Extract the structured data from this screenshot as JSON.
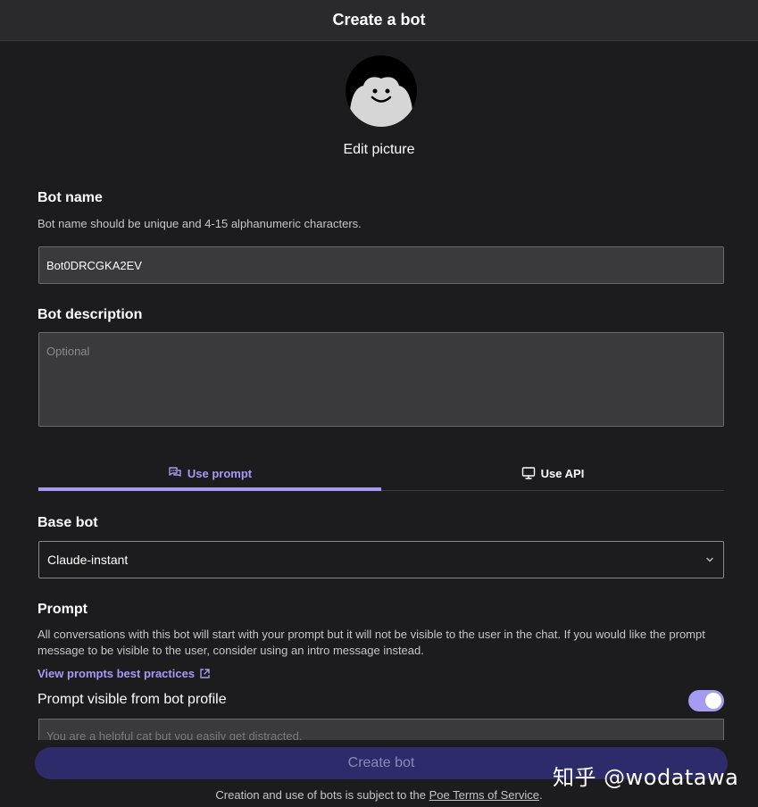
{
  "header": {
    "title": "Create a bot"
  },
  "avatar": {
    "edit_label": "Edit picture"
  },
  "bot_name": {
    "label": "Bot name",
    "helper": "Bot name should be unique and 4-15 alphanumeric characters.",
    "value": "Bot0DRCGKA2EV"
  },
  "bot_description": {
    "label": "Bot description",
    "placeholder": "Optional"
  },
  "tabs": [
    {
      "label": "Use prompt",
      "icon": "chat-bubbles-icon",
      "active": true
    },
    {
      "label": "Use API",
      "icon": "monitor-icon",
      "active": false
    }
  ],
  "base_bot": {
    "label": "Base bot",
    "selected": "Claude-instant"
  },
  "prompt": {
    "label": "Prompt",
    "helper": "All conversations with this bot will start with your prompt but it will not be visible to the user in the chat. If you would like the prompt message to be visible to the user, consider using an intro message instead.",
    "link": "View prompts best practices",
    "visible_label": "Prompt visible from bot profile",
    "visible_on": true,
    "placeholder": "You are a helpful cat but you easily get distracted."
  },
  "create_button": {
    "label": "Create bot"
  },
  "footer": {
    "text_before": "Creation and use of bots is subject to the ",
    "link": "Poe Terms of Service",
    "text_after": "."
  },
  "watermark": {
    "text": "知乎 @wodatawa"
  },
  "colors": {
    "accent": "#a49bf2",
    "background": "#1c1c1e",
    "input_bg": "#3a3a3c",
    "button_bg": "#2e2b6b"
  }
}
